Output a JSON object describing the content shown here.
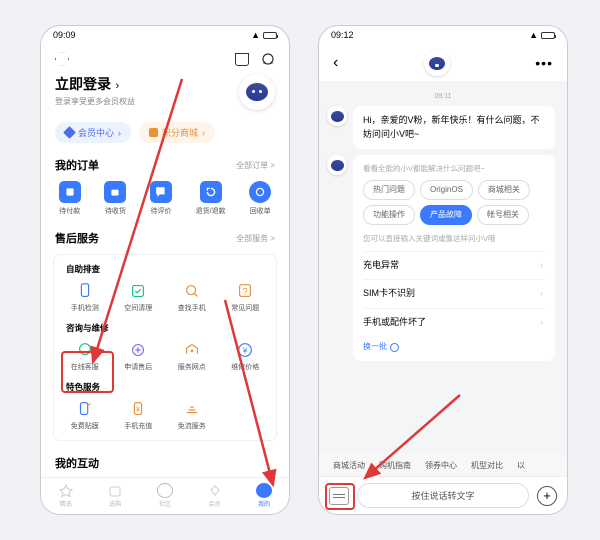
{
  "left": {
    "status_time": "09:09",
    "login_title": "立即登录",
    "login_sub": "登录享受更多会员权益",
    "chip_member": "会员中心",
    "chip_points": "积分商城",
    "orders_title": "我的订单",
    "orders_more": "全部订单 >",
    "order_items": [
      "待付款",
      "待收货",
      "待评价",
      "退货/退款",
      "回收单"
    ],
    "after_title": "售后服务",
    "after_more": "全部服务 >",
    "svc_sub1": "自助排查",
    "svc1": [
      "手机检测",
      "空间清理",
      "查找手机",
      "常见问题"
    ],
    "svc_sub2": "咨询与维修",
    "svc2": [
      "在线客服",
      "申请售后",
      "服务网点",
      "维修价格"
    ],
    "svc_sub3": "特色服务",
    "svc3": [
      "免费贴膜",
      "手机充值",
      "免流服务"
    ],
    "interact_title": "我的互动",
    "tabs": [
      "精选",
      "选购",
      "社区",
      "会员",
      "我的"
    ]
  },
  "right": {
    "status_time": "09:12",
    "chat_time": "09:11",
    "greeting": "Hi，亲爱的V粉，新年快乐！有什么问题，不妨问问小V吧~",
    "cat_head": "看看全能的小V都能解决什么问题吧~",
    "cats": [
      "热门问题",
      "OriginOS",
      "商城相关",
      "功能操作",
      "产品故障",
      "帐号相关"
    ],
    "q_head": "您可以直接输入关键词或像这样问小V哦",
    "qs": [
      "充电异常",
      "SIM卡不识别",
      "手机或配件坏了"
    ],
    "swap": "换一批",
    "sugs": [
      "商城活动",
      "购机指南",
      "领券中心",
      "机型对比",
      "以"
    ],
    "voice_label": "按住说话转文字"
  }
}
